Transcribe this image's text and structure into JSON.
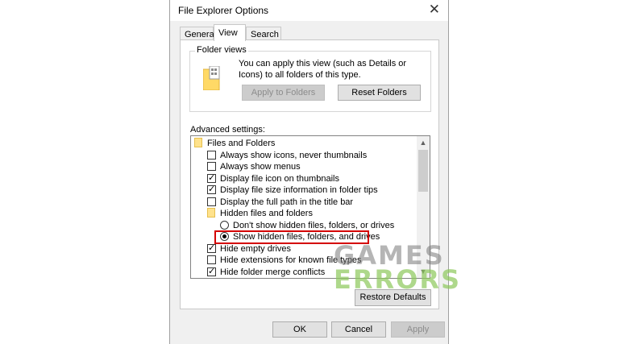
{
  "window": {
    "title": "File Explorer Options",
    "close_glyph": "✕"
  },
  "tabs": [
    {
      "label": "General",
      "active": false
    },
    {
      "label": "View",
      "active": true
    },
    {
      "label": "Search",
      "active": false
    }
  ],
  "folder_views": {
    "legend": "Folder views",
    "description": "You can apply this view (such as Details or Icons) to all folders of this type.",
    "apply_button": "Apply to Folders",
    "reset_button": "Reset Folders"
  },
  "advanced": {
    "label": "Advanced settings:",
    "items": [
      {
        "type": "folder",
        "label": "Files and Folders"
      },
      {
        "type": "checkbox",
        "label": "Always show icons, never thumbnails",
        "checked": false
      },
      {
        "type": "checkbox",
        "label": "Always show menus",
        "checked": false
      },
      {
        "type": "checkbox",
        "label": "Display file icon on thumbnails",
        "checked": true
      },
      {
        "type": "checkbox",
        "label": "Display file size information in folder tips",
        "checked": true
      },
      {
        "type": "checkbox",
        "label": "Display the full path in the title bar",
        "checked": false
      },
      {
        "type": "folder",
        "label": "Hidden files and folders"
      },
      {
        "type": "radio",
        "label": "Don't show hidden files, folders, or drives",
        "selected": false
      },
      {
        "type": "radio",
        "label": "Show hidden files, folders, and drives",
        "selected": true
      },
      {
        "type": "checkbox",
        "label": "Hide empty drives",
        "checked": true
      },
      {
        "type": "checkbox",
        "label": "Hide extensions for known file types",
        "checked": false
      },
      {
        "type": "checkbox",
        "label": "Hide folder merge conflicts",
        "checked": true
      }
    ]
  },
  "restore_button": "Restore Defaults",
  "footer": {
    "ok": "OK",
    "cancel": "Cancel",
    "apply": "Apply"
  },
  "watermark": {
    "line1": "GAMES",
    "line2": "ERRORS"
  },
  "colors": {
    "highlight": "#d40000",
    "focus": "#0078d7"
  }
}
